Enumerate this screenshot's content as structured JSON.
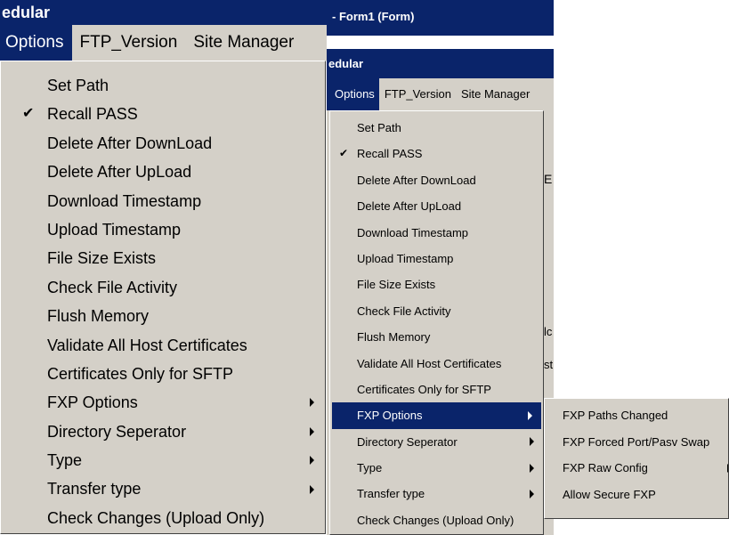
{
  "left": {
    "title": "edular",
    "menubar": [
      "Options",
      "FTP_Version",
      "Site Manager"
    ],
    "menu": [
      {
        "label": "Set Path"
      },
      {
        "label": "Recall PASS",
        "checked": true
      },
      {
        "label": "Delete After DownLoad"
      },
      {
        "label": "Delete After UpLoad"
      },
      {
        "label": "Download Timestamp"
      },
      {
        "label": "Upload Timestamp"
      },
      {
        "label": "File Size Exists"
      },
      {
        "label": "Check File Activity"
      },
      {
        "label": "Flush Memory"
      },
      {
        "label": "Validate All Host Certificates"
      },
      {
        "label": "Certificates Only for SFTP"
      },
      {
        "label": "FXP Options",
        "submenu": true
      },
      {
        "label": "Directory Seperator",
        "submenu": true
      },
      {
        "label": "Type",
        "submenu": true
      },
      {
        "label": "Transfer type",
        "submenu": true
      },
      {
        "label": "Check Changes (Upload Only)"
      }
    ]
  },
  "right": {
    "window_title": "- Form1 (Form)",
    "title": "edular",
    "menubar": [
      "Options",
      "FTP_Version",
      "Site Manager"
    ],
    "menu": [
      {
        "label": "Set Path"
      },
      {
        "label": "Recall PASS",
        "checked": true
      },
      {
        "label": "Delete After DownLoad"
      },
      {
        "label": "Delete After UpLoad"
      },
      {
        "label": "Download Timestamp"
      },
      {
        "label": "Upload Timestamp"
      },
      {
        "label": "File Size Exists"
      },
      {
        "label": "Check File Activity"
      },
      {
        "label": "Flush Memory"
      },
      {
        "label": "Validate All Host Certificates"
      },
      {
        "label": "Certificates Only for SFTP"
      },
      {
        "label": "FXP Options",
        "submenu": true,
        "highlighted": true
      },
      {
        "label": "Directory Seperator",
        "submenu": true
      },
      {
        "label": "Type",
        "submenu": true
      },
      {
        "label": "Transfer type",
        "submenu": true
      },
      {
        "label": "Check Changes (Upload Only)"
      }
    ],
    "submenu": [
      {
        "label": "FXP Paths Changed"
      },
      {
        "label": "FXP Forced Port/Pasv Swap"
      },
      {
        "label": "FXP Raw Config",
        "submenu": true
      },
      {
        "label": "Allow Secure FXP"
      }
    ],
    "background_fragments": [
      "E",
      "lc",
      "st"
    ]
  },
  "icons": {
    "check": "checkmark-icon",
    "submenu_arrow": "triangle-right-icon"
  },
  "colors": {
    "highlight": "#0a246a",
    "menu_bg": "#d4d0c8",
    "titlebar": "#0a246a"
  }
}
